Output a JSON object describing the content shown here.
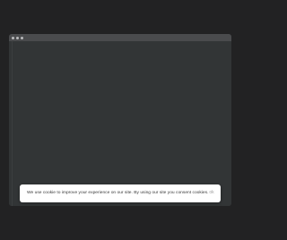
{
  "cookie_banner": {
    "message": "We use cookie to improve your experience on our site. By using our site you consent cookies.",
    "close_label": "ok"
  }
}
